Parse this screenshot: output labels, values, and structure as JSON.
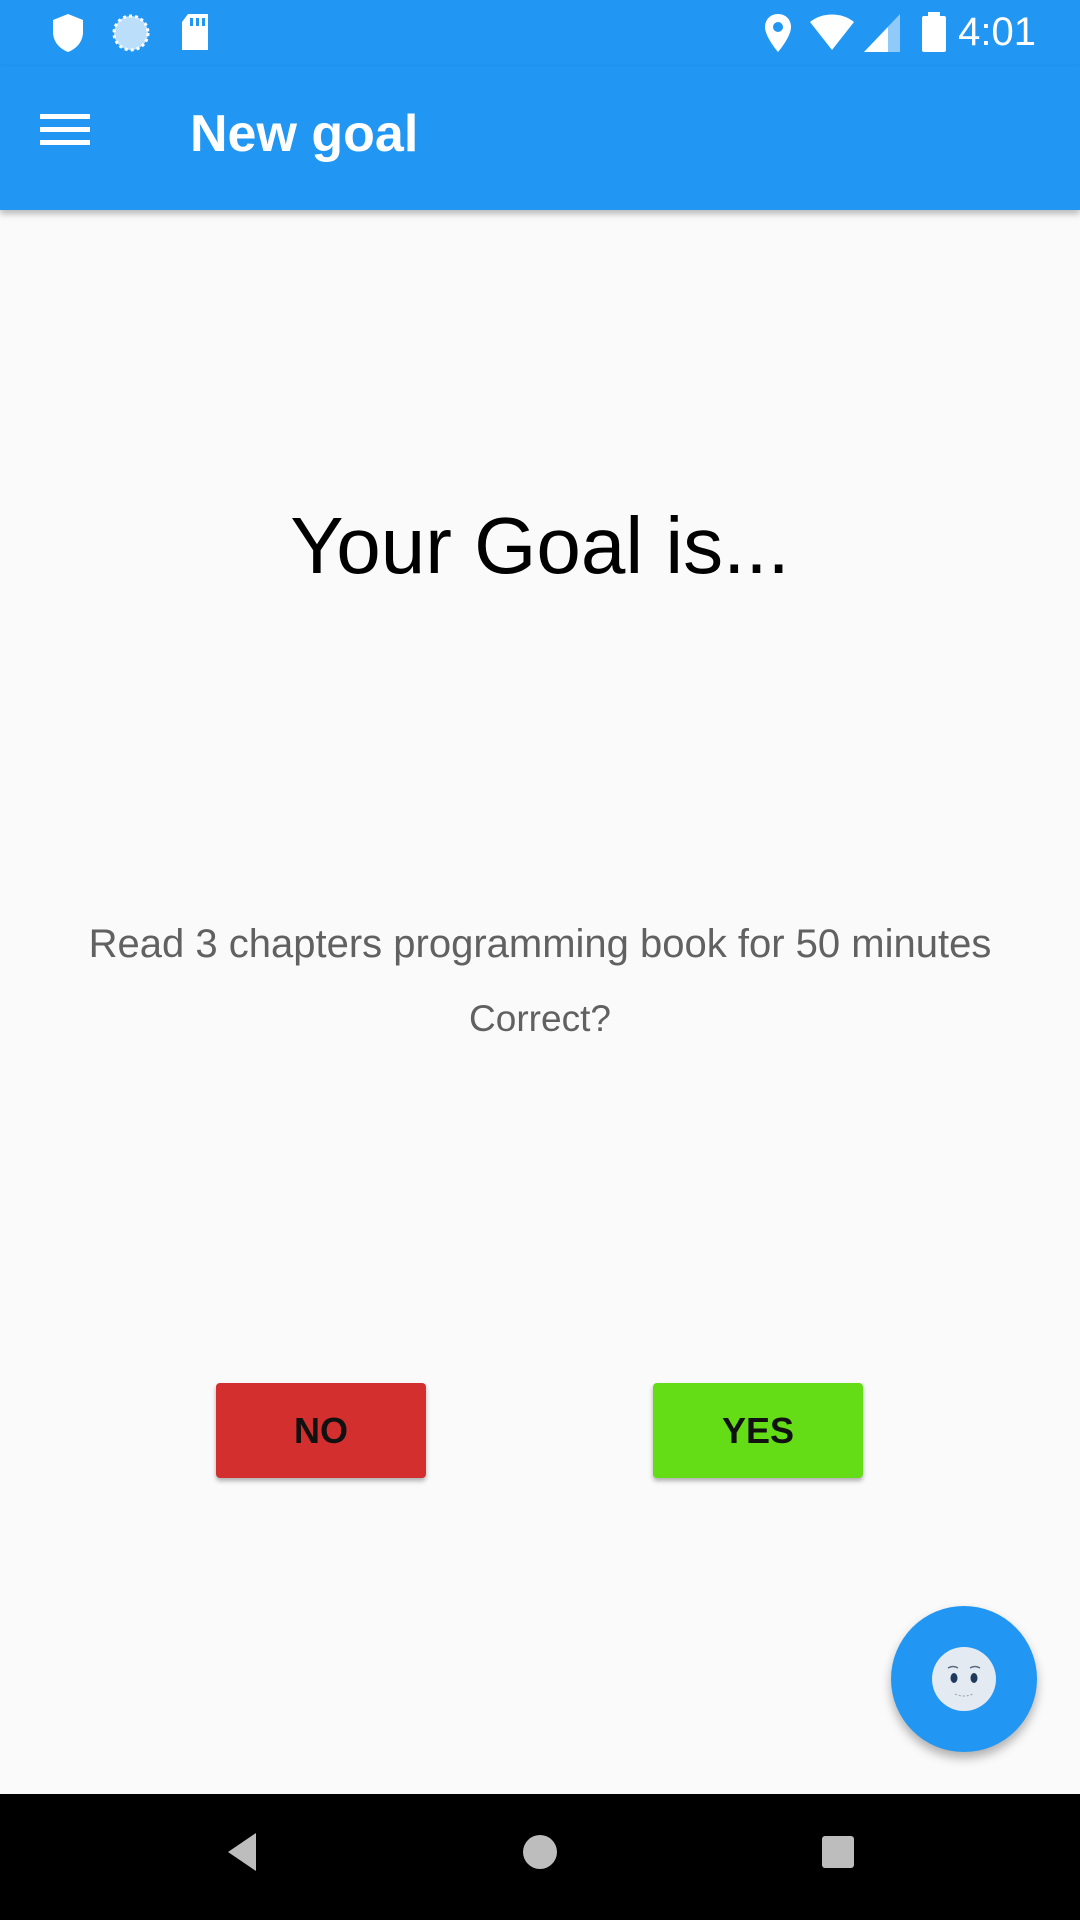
{
  "status_bar": {
    "time": "4:01",
    "icons": [
      "shield-icon",
      "sync-icon",
      "sd-card-icon",
      "location-icon",
      "wifi-icon",
      "cell-signal-icon",
      "battery-icon"
    ]
  },
  "app_bar": {
    "menu_icon": "hamburger-menu-icon",
    "title": "New goal",
    "color": "#2196f3"
  },
  "main": {
    "heading": "Your Goal is...",
    "goal_text": "Read 3 chapters programming book for 50 minutes",
    "question": "Correct?",
    "buttons": {
      "no_label": "NO",
      "no_color": "#d32f2f",
      "yes_label": "YES",
      "yes_color": "#64dd17"
    }
  },
  "fab": {
    "icon": "assistant-face-icon"
  },
  "nav_bar": {
    "icons": [
      "back-icon",
      "home-icon",
      "recents-icon"
    ]
  }
}
